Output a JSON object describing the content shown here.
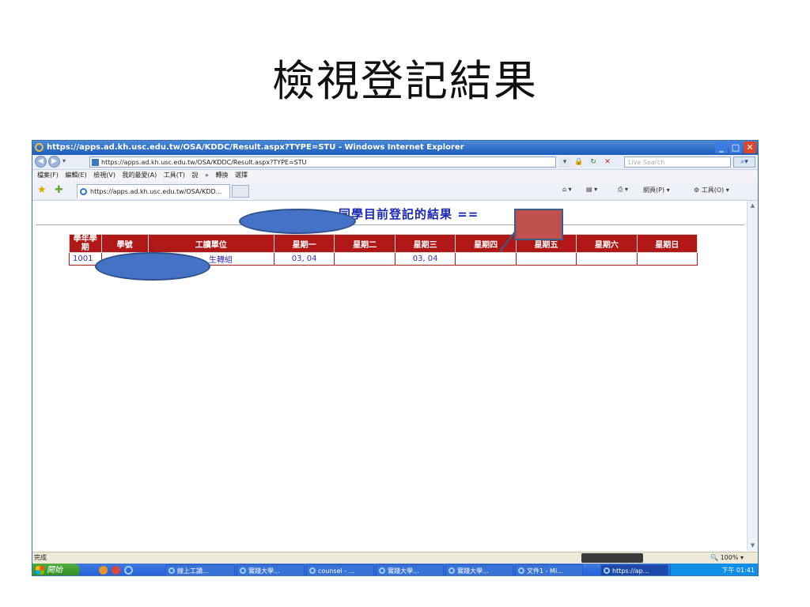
{
  "slide": {
    "title": "檢視登記結果"
  },
  "browser": {
    "window_title": "https://apps.ad.kh.usc.edu.tw/OSA/KDDC/Result.aspx?TYPE=STU - Windows Internet Explorer",
    "address": "https://apps.ad.kh.usc.edu.tw/OSA/KDDC/Result.aspx?TYPE=STU",
    "search_placeholder": "Live Search",
    "menu": [
      "檔案(F)",
      "編輯(E)",
      "檢視(V)",
      "我的最愛(A)",
      "工具(T)",
      "說",
      "»",
      "轉換",
      "選擇"
    ],
    "tab_label": "https://apps.ad.kh.usc.edu.tw/OSA/KDD...",
    "commands": {
      "page": "網頁(P)",
      "tools": "工具(O)"
    },
    "status_done": "完成",
    "zoom": "100%"
  },
  "page": {
    "heading": "同學目前登記的結果 ==",
    "table": {
      "headers": [
        "學年學期",
        "學號",
        "工讀單位",
        "星期一",
        "星期二",
        "星期三",
        "星期四",
        "星期五",
        "星期六",
        "星期日"
      ],
      "rows": [
        [
          "1001",
          "",
          "生轉組",
          "03, 04",
          "",
          "03, 04",
          "",
          "",
          "",
          ""
        ]
      ]
    }
  },
  "taskbar": {
    "start": "開始",
    "items": [
      "線上工讀...",
      "實踐大學...",
      "counsel - ...",
      "實踐大學...",
      "實踐大學...",
      "文件1 - Mi...",
      "https://ap..."
    ],
    "clock": "下午 01:41"
  },
  "colors": {
    "table_header": "#b01818",
    "link_text": "#3a2bb0",
    "redact_oval": "#4472c4",
    "redact_box": "#c0504d"
  }
}
